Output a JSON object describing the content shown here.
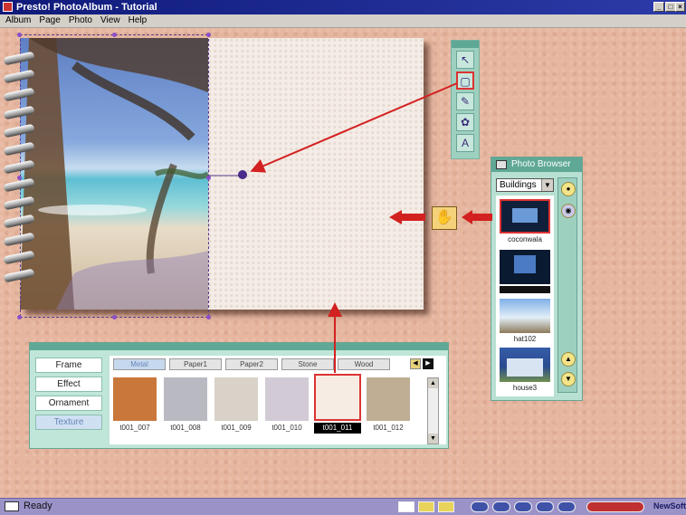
{
  "window": {
    "title": "Presto! PhotoAlbum - Tutorial"
  },
  "menu": [
    "Album",
    "Page",
    "Photo",
    "View",
    "Help"
  ],
  "tools": [
    {
      "icon": "arrow-pointer-icon"
    },
    {
      "icon": "frame-select-icon",
      "selected": true
    },
    {
      "icon": "magic-wand-icon"
    },
    {
      "icon": "paint-brush-icon"
    },
    {
      "icon": "text-tool-icon"
    }
  ],
  "photo_browser": {
    "title": "Photo Browser",
    "category": "Buildings",
    "thumbs": [
      {
        "caption": "coconwala",
        "selected": true
      },
      {
        "caption": "",
        "highlight": true
      },
      {
        "caption": "hat102"
      },
      {
        "caption": "house3"
      }
    ]
  },
  "texture_panel": {
    "categories": [
      {
        "label": "Frame",
        "active": false
      },
      {
        "label": "Effect",
        "active": false
      },
      {
        "label": "Ornament",
        "active": false
      },
      {
        "label": "Texture",
        "active": true
      }
    ],
    "tabs": [
      {
        "label": "Metal",
        "active": true
      },
      {
        "label": "Paper1",
        "active": false
      },
      {
        "label": "Paper2",
        "active": false
      },
      {
        "label": "Stone",
        "active": false
      },
      {
        "label": "Wood",
        "active": false
      }
    ],
    "textures": [
      {
        "caption": "t001_007",
        "color": "#c9773a"
      },
      {
        "caption": "t001_008",
        "color": "#b9b9c2"
      },
      {
        "caption": "t001_009",
        "color": "#d8d2c8"
      },
      {
        "caption": "t001_010",
        "color": "#d2cbd6"
      },
      {
        "caption": "t001_011",
        "color": "#f6ece4",
        "selected": true
      },
      {
        "caption": "t001_012",
        "color": "#bfae94"
      }
    ]
  },
  "status": {
    "text": "Ready",
    "brand": "NewSoft"
  },
  "colors": {
    "canvas": "#e6b69f",
    "panel": "#bfe6d8",
    "panel_header": "#5fa896",
    "arrow": "#d32020"
  }
}
